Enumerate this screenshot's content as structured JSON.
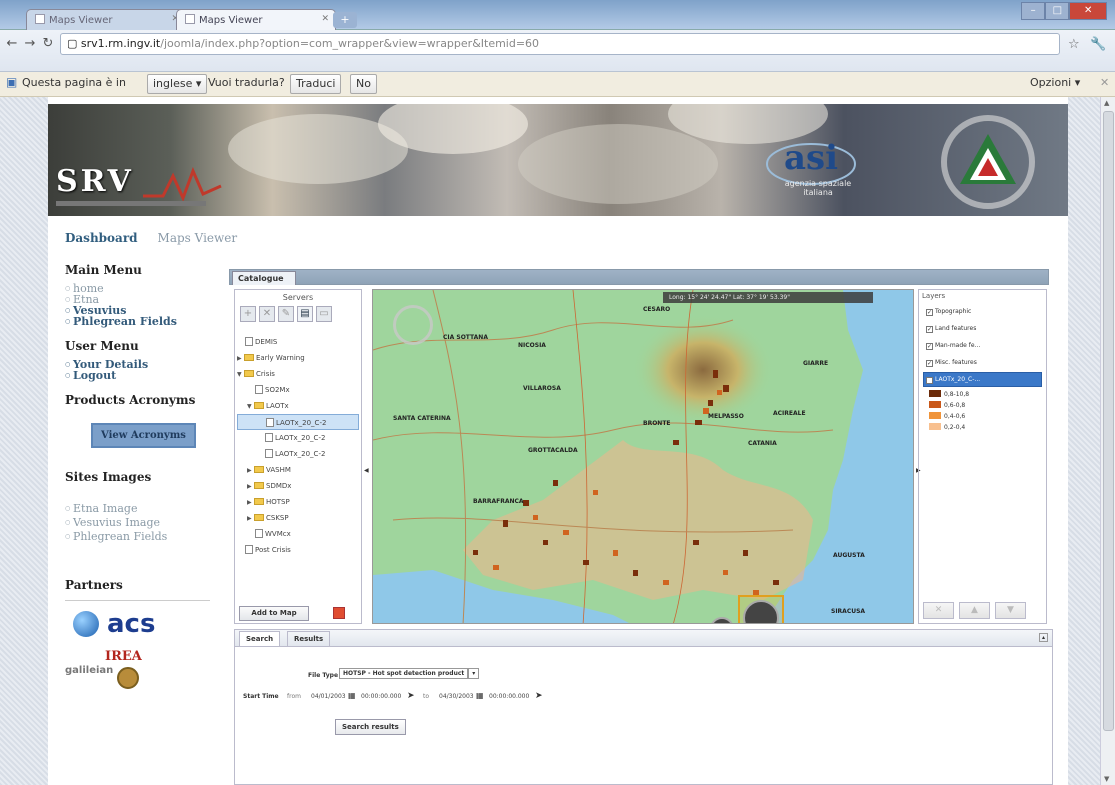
{
  "browser": {
    "tabs": [
      {
        "title": "Maps Viewer",
        "active": false
      },
      {
        "title": "Maps Viewer",
        "active": true
      }
    ],
    "url_host": "srv1.rm.ingv.it",
    "url_rest": "/joomla/index.php?option=com_wrapper&view=wrapper&Itemid=60"
  },
  "translate_bar": {
    "prefix": "Questa pagina è in",
    "language": "inglese ▾",
    "question": "Vuoi tradurla?",
    "translate_btn": "Traduci",
    "no_btn": "No",
    "options": "Opzioni ▾"
  },
  "header": {
    "logo": "SRV",
    "asi_text": "agenzia spaziale italiana",
    "breadcrumbs": [
      "Dashboard",
      "Maps Viewer"
    ]
  },
  "sidebar": {
    "main_menu_title": "Main Menu",
    "main_menu": [
      {
        "label": "home",
        "bold": false
      },
      {
        "label": "Etna",
        "bold": false
      },
      {
        "label": "Vesuvius",
        "bold": true
      },
      {
        "label": "Phlegrean Fields",
        "bold": true
      }
    ],
    "user_menu_title": "User Menu",
    "user_menu": [
      {
        "label": "Your Details",
        "bold": true
      },
      {
        "label": "Logout",
        "bold": true
      }
    ],
    "products_title": "Products Acronyms",
    "view_acronyms": "View Acronyms",
    "sites_title": "Sites Images",
    "sites": [
      {
        "label": "Etna Image"
      },
      {
        "label": "Vesuvius Image"
      },
      {
        "label": "Phlegrean Fields"
      }
    ],
    "partners_title": "Partners",
    "partners": [
      "acs",
      "IREA",
      "galileian"
    ]
  },
  "catalogue": {
    "tab_label": "Catalogue",
    "servers_label": "Servers",
    "tree": [
      {
        "label": "DEMIS",
        "kind": "doc",
        "depth": 0
      },
      {
        "label": "Early Warning",
        "kind": "folder",
        "depth": 0
      },
      {
        "label": "Crisis",
        "kind": "folder",
        "depth": 0,
        "open": true
      },
      {
        "label": "SO2Mx",
        "kind": "doc",
        "depth": 1
      },
      {
        "label": "LAOTx",
        "kind": "folder",
        "depth": 1,
        "open": true
      },
      {
        "label": "LAOTx_20_C-2",
        "kind": "doc",
        "depth": 2,
        "selected": true
      },
      {
        "label": "LAOTx_20_C-2",
        "kind": "doc",
        "depth": 2
      },
      {
        "label": "LAOTx_20_C-2",
        "kind": "doc",
        "depth": 2
      },
      {
        "label": "VASHM",
        "kind": "folder",
        "depth": 1
      },
      {
        "label": "SDMDx",
        "kind": "folder",
        "depth": 1
      },
      {
        "label": "HOTSP",
        "kind": "folder",
        "depth": 1
      },
      {
        "label": "CSKSP",
        "kind": "folder",
        "depth": 1
      },
      {
        "label": "WVMcx",
        "kind": "doc",
        "depth": 1
      },
      {
        "label": "Post Crisis",
        "kind": "doc",
        "depth": 0
      }
    ],
    "add_to_map": "Add to Map"
  },
  "map": {
    "coords": "Long: 15° 24' 24.47\"     Lat: 37° 19' 53.39\"",
    "places": [
      "CESARO",
      "CIA SOTTANA",
      "NICOSIA",
      "VILLAROSA",
      "GIARRE",
      "SANTA CATERINA",
      "ACIREALE",
      "BRONTE",
      "MELPASSO",
      "CATANIA",
      "GROTTACALDA",
      "BARRAFRANCA",
      "AUGUSTA",
      "SIRACUSA"
    ]
  },
  "layers": {
    "title": "Layers",
    "items": [
      {
        "label": "Topographic",
        "checked": true,
        "selected": false
      },
      {
        "label": "Land features",
        "checked": true,
        "selected": false
      },
      {
        "label": "Man-made fe...",
        "checked": true,
        "selected": false
      },
      {
        "label": "Misc. features",
        "checked": true,
        "selected": false
      },
      {
        "label": "LAOTx_20_C-...",
        "checked": true,
        "selected": true
      }
    ],
    "legend": [
      {
        "label": "0,8-10,8",
        "color": "#6b2b0a"
      },
      {
        "label": "0,6-0,8",
        "color": "#c9581a"
      },
      {
        "label": "0,4-0,6",
        "color": "#f0943a"
      },
      {
        "label": "0,2-0,4",
        "color": "#f8c08f"
      }
    ]
  },
  "search": {
    "tabs": [
      "Search",
      "Results"
    ],
    "file_type_label": "File Type",
    "file_type_value": "HOTSP - Hot spot detection product",
    "start_time_label": "Start Time",
    "from_label": "from",
    "from_date": "04/01/2003",
    "from_time": "00:00:00.000",
    "to_label": "to",
    "to_date": "04/30/2003",
    "to_time": "00:00:00.000",
    "search_button": "Search results"
  }
}
